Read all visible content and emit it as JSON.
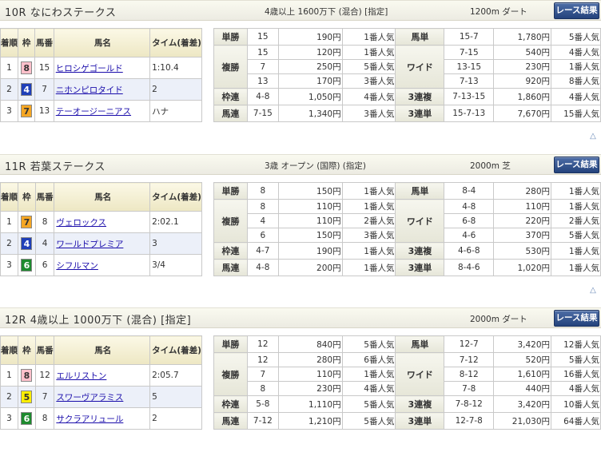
{
  "header_cols": {
    "finish": "着順",
    "waku": "枠",
    "umaban": "馬番",
    "horse": "馬名",
    "time": "タイム(着差)"
  },
  "bet_labels": {
    "tansho": "単勝",
    "fukusho": "複勝",
    "wakuren": "枠連",
    "umaren": "馬連",
    "umatan": "馬単",
    "wide": "ワイド",
    "sanrenpuku": "3連複",
    "sanrentan": "3連単"
  },
  "result_button_label": "レース結果",
  "scroll_top_icon": "up-triangle-icon",
  "races": [
    {
      "name": "10R なにわステークス",
      "conditions": "4歳以上 1600万下 (混合) [指定]",
      "course": "1200m ダート",
      "finishers": [
        {
          "pos": "1",
          "waku": "8",
          "waku_bg": "#ffc0cb",
          "waku_fg": "#333333",
          "num": "15",
          "horse": "ヒロシゲゴールド",
          "time": "1:10.4"
        },
        {
          "pos": "2",
          "waku": "4",
          "waku_bg": "#1f3fb8",
          "waku_fg": "#ffffff",
          "num": "7",
          "horse": "ニホンピロタイド",
          "time": "2"
        },
        {
          "pos": "3",
          "waku": "7",
          "waku_bg": "#f5a623",
          "waku_fg": "#333333",
          "num": "13",
          "horse": "テーオージーニアス",
          "time": "ハナ"
        }
      ],
      "tansho": {
        "combo": "15",
        "pay": "190円",
        "pop": "1番人気"
      },
      "fukusho": [
        {
          "combo": "15",
          "pay": "120円",
          "pop": "1番人気"
        },
        {
          "combo": "7",
          "pay": "250円",
          "pop": "5番人気"
        },
        {
          "combo": "13",
          "pay": "170円",
          "pop": "3番人気"
        }
      ],
      "wakuren": {
        "combo": "4-8",
        "pay": "1,050円",
        "pop": "4番人気"
      },
      "umaren": {
        "combo": "7-15",
        "pay": "1,340円",
        "pop": "3番人気"
      },
      "umatan": {
        "combo": "15-7",
        "pay": "1,780円",
        "pop": "5番人気"
      },
      "wide": [
        {
          "combo": "7-15",
          "pay": "540円",
          "pop": "4番人気"
        },
        {
          "combo": "13-15",
          "pay": "230円",
          "pop": "1番人気"
        },
        {
          "combo": "7-13",
          "pay": "920円",
          "pop": "8番人気"
        }
      ],
      "sanrenpuku": {
        "combo": "7-13-15",
        "pay": "1,860円",
        "pop": "4番人気"
      },
      "sanrentan": {
        "combo": "15-7-13",
        "pay": "7,670円",
        "pop": "15番人気"
      }
    },
    {
      "name": "11R 若葉ステークス",
      "conditions": "3歳 オープン (国際) (指定)",
      "course": "2000m 芝",
      "finishers": [
        {
          "pos": "1",
          "waku": "7",
          "waku_bg": "#f5a623",
          "waku_fg": "#333333",
          "num": "8",
          "horse": "ヴェロックス",
          "time": "2:02.1"
        },
        {
          "pos": "2",
          "waku": "4",
          "waku_bg": "#1f3fb8",
          "waku_fg": "#ffffff",
          "num": "4",
          "horse": "ワールドプレミア",
          "time": "3"
        },
        {
          "pos": "3",
          "waku": "6",
          "waku_bg": "#1d8a2e",
          "waku_fg": "#ffffff",
          "num": "6",
          "horse": "シフルマン",
          "time": "3/4"
        }
      ],
      "tansho": {
        "combo": "8",
        "pay": "150円",
        "pop": "1番人気"
      },
      "fukusho": [
        {
          "combo": "8",
          "pay": "110円",
          "pop": "1番人気"
        },
        {
          "combo": "4",
          "pay": "110円",
          "pop": "2番人気"
        },
        {
          "combo": "6",
          "pay": "150円",
          "pop": "3番人気"
        }
      ],
      "wakuren": {
        "combo": "4-7",
        "pay": "190円",
        "pop": "1番人気"
      },
      "umaren": {
        "combo": "4-8",
        "pay": "200円",
        "pop": "1番人気"
      },
      "umatan": {
        "combo": "8-4",
        "pay": "280円",
        "pop": "1番人気"
      },
      "wide": [
        {
          "combo": "4-8",
          "pay": "110円",
          "pop": "1番人気"
        },
        {
          "combo": "6-8",
          "pay": "220円",
          "pop": "2番人気"
        },
        {
          "combo": "4-6",
          "pay": "370円",
          "pop": "5番人気"
        }
      ],
      "sanrenpuku": {
        "combo": "4-6-8",
        "pay": "530円",
        "pop": "1番人気"
      },
      "sanrentan": {
        "combo": "8-4-6",
        "pay": "1,020円",
        "pop": "1番人気"
      }
    },
    {
      "name": "12R 4歳以上 1000万下 (混合) [指定]",
      "conditions": "",
      "course": "2000m ダート",
      "finishers": [
        {
          "pos": "1",
          "waku": "8",
          "waku_bg": "#ffc0cb",
          "waku_fg": "#333333",
          "num": "12",
          "horse": "エルリストン",
          "time": "2:05.7"
        },
        {
          "pos": "2",
          "waku": "5",
          "waku_bg": "#ffee00",
          "waku_fg": "#333333",
          "num": "7",
          "horse": "スワーヴアラミス",
          "time": "5"
        },
        {
          "pos": "3",
          "waku": "6",
          "waku_bg": "#1d8a2e",
          "waku_fg": "#ffffff",
          "num": "8",
          "horse": "サクラアリュール",
          "time": "2"
        }
      ],
      "tansho": {
        "combo": "12",
        "pay": "840円",
        "pop": "5番人気"
      },
      "fukusho": [
        {
          "combo": "12",
          "pay": "280円",
          "pop": "6番人気"
        },
        {
          "combo": "7",
          "pay": "110円",
          "pop": "1番人気"
        },
        {
          "combo": "8",
          "pay": "230円",
          "pop": "4番人気"
        }
      ],
      "wakuren": {
        "combo": "5-8",
        "pay": "1,110円",
        "pop": "5番人気"
      },
      "umaren": {
        "combo": "7-12",
        "pay": "1,210円",
        "pop": "5番人気"
      },
      "umatan": {
        "combo": "12-7",
        "pay": "3,420円",
        "pop": "12番人気"
      },
      "wide": [
        {
          "combo": "7-12",
          "pay": "520円",
          "pop": "5番人気"
        },
        {
          "combo": "8-12",
          "pay": "1,610円",
          "pop": "16番人気"
        },
        {
          "combo": "7-8",
          "pay": "440円",
          "pop": "4番人気"
        }
      ],
      "sanrenpuku": {
        "combo": "7-8-12",
        "pay": "3,420円",
        "pop": "10番人気"
      },
      "sanrentan": {
        "combo": "12-7-8",
        "pay": "21,030円",
        "pop": "64番人気"
      }
    }
  ]
}
